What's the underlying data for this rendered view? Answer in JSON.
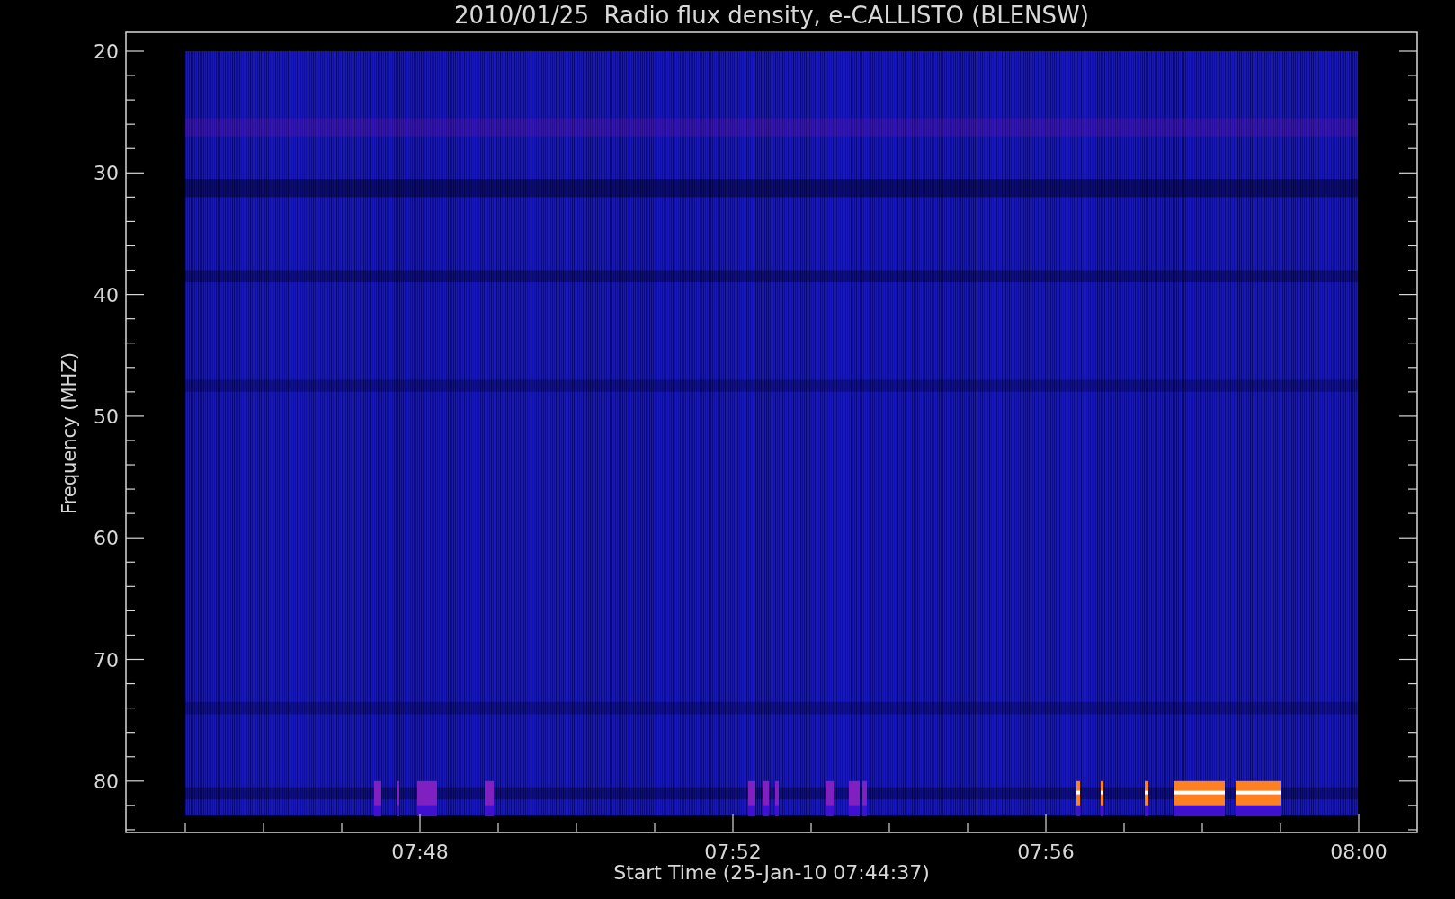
{
  "title": "2010/01/25  Radio flux density, e-CALLISTO (BLENSW)",
  "y_axis": {
    "label": "Frequency (MHZ)",
    "ticks": [
      "20",
      "30",
      "40",
      "50",
      "60",
      "70",
      "80"
    ]
  },
  "x_axis": {
    "label": "Start Time (25-Jan-10 07:44:37)",
    "ticks": [
      "07:48",
      "07:52",
      "07:56",
      "08:00"
    ]
  }
}
